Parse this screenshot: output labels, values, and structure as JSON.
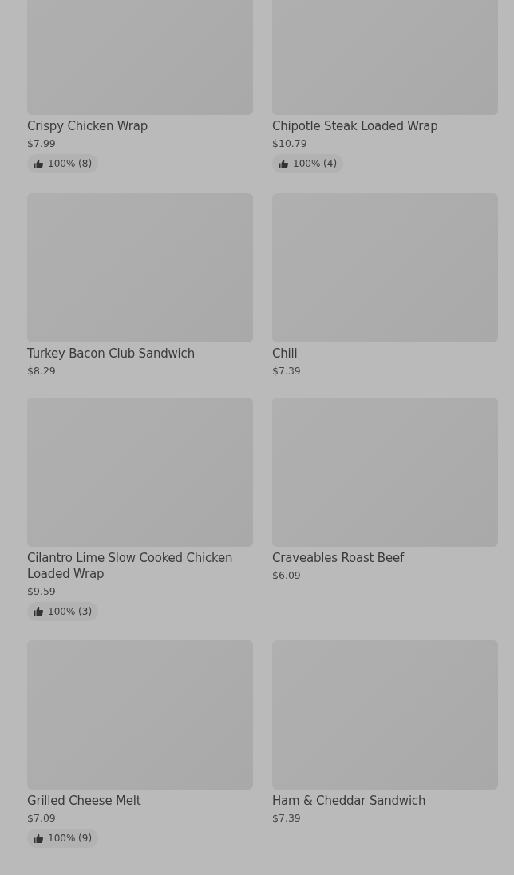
{
  "items": [
    {
      "name": "Crispy Chicken Wrap",
      "price": "$7.99",
      "rating": "100% (8)"
    },
    {
      "name": "Chipotle Steak Loaded Wrap",
      "price": "$10.79",
      "rating": "100% (4)"
    },
    {
      "name": "Turkey Bacon Club Sandwich",
      "price": "$8.29"
    },
    {
      "name": "Chili",
      "price": "$7.39"
    },
    {
      "name": "Cilantro Lime Slow Cooked Chicken Loaded Wrap",
      "price": "$9.59",
      "rating": "100% (3)"
    },
    {
      "name": "Craveables Roast Beef",
      "price": "$6.09"
    },
    {
      "name": "Grilled Cheese Melt",
      "price": "$7.09",
      "rating": "100% (9)"
    },
    {
      "name": "Ham & Cheddar Sandwich",
      "price": "$7.39"
    }
  ]
}
